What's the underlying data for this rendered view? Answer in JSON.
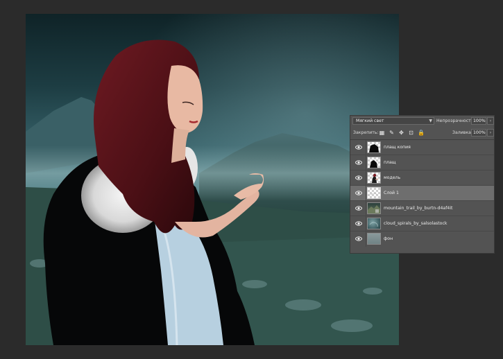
{
  "canvas": {
    "description_icon": "document-canvas"
  },
  "layers_panel": {
    "blend_mode": "Мягкий свет",
    "opacity_label": "Непрозрачность:",
    "opacity_value": "100%",
    "lock_label": "Закрепить:",
    "fill_label": "Заливка:",
    "fill_value": "100%",
    "layers": [
      {
        "name": "плащ копия",
        "visible": true,
        "selected": false,
        "thumb": "checker-black-shape"
      },
      {
        "name": "плащ",
        "visible": true,
        "selected": false,
        "thumb": "checker-black-shape"
      },
      {
        "name": "модель",
        "visible": true,
        "selected": false,
        "thumb": "checker-figure"
      },
      {
        "name": "Слой 1",
        "visible": true,
        "selected": true,
        "thumb": "checker-empty"
      },
      {
        "name": "mountain_trail_by_burtn-d4af4it",
        "visible": true,
        "selected": false,
        "thumb": "photo-mountain"
      },
      {
        "name": "cloud_spirals_by_salsolastock",
        "visible": true,
        "selected": false,
        "thumb": "photo-cloud"
      },
      {
        "name": "фон",
        "visible": true,
        "selected": false,
        "thumb": "solid-gray"
      }
    ]
  }
}
